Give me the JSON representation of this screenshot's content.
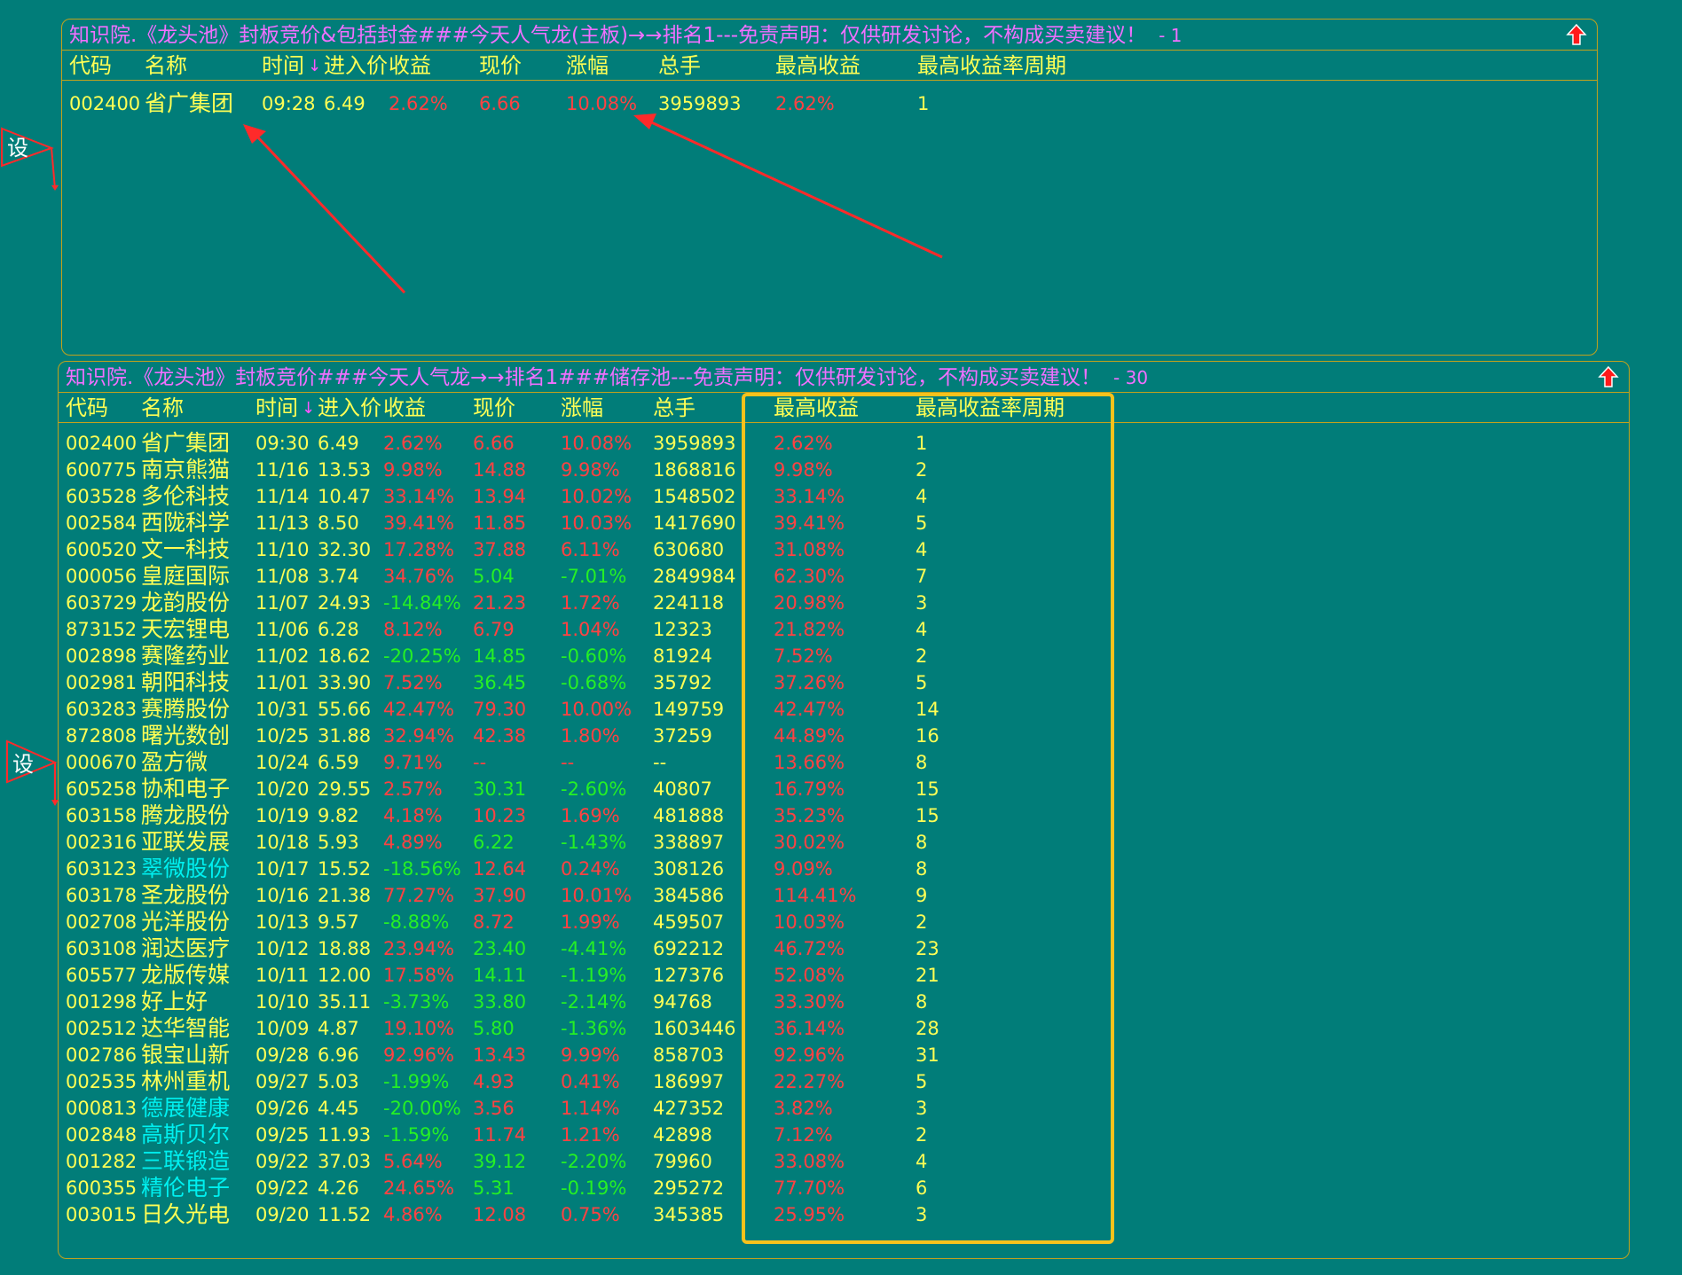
{
  "top_panel": {
    "title": "知识院.《龙头池》封板竞价&包括封金###今天人气龙(主板)→→排名1---免责声明：仅供研发讨论，不构成买卖建议！",
    "count": "- 1",
    "headers": [
      "代码",
      "名称",
      "时间",
      "进入价",
      "收益",
      "现价",
      "涨幅",
      "总手",
      "最高收益",
      "最高收益率周期"
    ],
    "rows": [
      {
        "code": "002400",
        "name": "省广集团",
        "time": "09:28",
        "entry": "6.49",
        "profit": "2.62%",
        "price": "6.66",
        "change": "10.08%",
        "volume": "3959893",
        "max_profit": "2.62%",
        "period": "1",
        "name_color": "yellow",
        "profit_color": "red",
        "price_color": "red",
        "change_color": "red",
        "max_color": "red"
      }
    ]
  },
  "bottom_panel": {
    "title": "知识院.《龙头池》封板竞价###今天人气龙→→排名1###储存池---免责声明：仅供研发讨论，不构成买卖建议！",
    "count": "- 30",
    "headers": [
      "代码",
      "名称",
      "时间",
      "进入价",
      "收益",
      "现价",
      "涨幅",
      "总手",
      "最高收益",
      "最高收益率周期"
    ],
    "rows": [
      {
        "code": "002400",
        "name": "省广集团",
        "time": "09:30",
        "entry": "6.49",
        "profit": "2.62%",
        "price": "6.66",
        "change": "10.08%",
        "volume": "3959893",
        "max_profit": "2.62%",
        "period": "1",
        "name_color": "yellow",
        "profit_color": "red",
        "price_color": "red",
        "change_color": "red"
      },
      {
        "code": "600775",
        "name": "南京熊猫",
        "time": "11/16",
        "entry": "13.53",
        "profit": "9.98%",
        "price": "14.88",
        "change": "9.98%",
        "volume": "1868816",
        "max_profit": "9.98%",
        "period": "2",
        "name_color": "yellow",
        "profit_color": "red",
        "price_color": "red",
        "change_color": "red"
      },
      {
        "code": "603528",
        "name": "多伦科技",
        "time": "11/14",
        "entry": "10.47",
        "profit": "33.14%",
        "price": "13.94",
        "change": "10.02%",
        "volume": "1548502",
        "max_profit": "33.14%",
        "period": "4",
        "name_color": "yellow",
        "profit_color": "red",
        "price_color": "red",
        "change_color": "red"
      },
      {
        "code": "002584",
        "name": "西陇科学",
        "time": "11/13",
        "entry": "8.50",
        "profit": "39.41%",
        "price": "11.85",
        "change": "10.03%",
        "volume": "1417690",
        "max_profit": "39.41%",
        "period": "5",
        "name_color": "yellow",
        "profit_color": "red",
        "price_color": "red",
        "change_color": "red"
      },
      {
        "code": "600520",
        "name": "文一科技",
        "time": "11/10",
        "entry": "32.30",
        "profit": "17.28%",
        "price": "37.88",
        "change": "6.11%",
        "volume": "630680",
        "max_profit": "31.08%",
        "period": "4",
        "name_color": "yellow",
        "profit_color": "red",
        "price_color": "red",
        "change_color": "red"
      },
      {
        "code": "000056",
        "name": "皇庭国际",
        "time": "11/08",
        "entry": "3.74",
        "profit": "34.76%",
        "price": "5.04",
        "change": "-7.01%",
        "volume": "2849984",
        "max_profit": "62.30%",
        "period": "7",
        "name_color": "yellow",
        "profit_color": "red",
        "price_color": "green",
        "change_color": "green"
      },
      {
        "code": "603729",
        "name": "龙韵股份",
        "time": "11/07",
        "entry": "24.93",
        "profit": "-14.84%",
        "price": "21.23",
        "change": "1.72%",
        "volume": "224118",
        "max_profit": "20.98%",
        "period": "3",
        "name_color": "yellow",
        "profit_color": "green",
        "price_color": "red",
        "change_color": "red"
      },
      {
        "code": "873152",
        "name": "天宏锂电",
        "time": "11/06",
        "entry": "6.28",
        "profit": "8.12%",
        "price": "6.79",
        "change": "1.04%",
        "volume": "12323",
        "max_profit": "21.82%",
        "period": "4",
        "name_color": "yellow",
        "profit_color": "red",
        "price_color": "red",
        "change_color": "red"
      },
      {
        "code": "002898",
        "name": "赛隆药业",
        "time": "11/02",
        "entry": "18.62",
        "profit": "-20.25%",
        "price": "14.85",
        "change": "-0.60%",
        "volume": "81924",
        "max_profit": "7.52%",
        "period": "2",
        "name_color": "yellow",
        "profit_color": "green",
        "price_color": "green",
        "change_color": "green"
      },
      {
        "code": "002981",
        "name": "朝阳科技",
        "time": "11/01",
        "entry": "33.90",
        "profit": "7.52%",
        "price": "36.45",
        "change": "-0.68%",
        "volume": "35792",
        "max_profit": "37.26%",
        "period": "5",
        "name_color": "yellow",
        "profit_color": "red",
        "price_color": "green",
        "change_color": "green"
      },
      {
        "code": "603283",
        "name": "赛腾股份",
        "time": "10/31",
        "entry": "55.66",
        "profit": "42.47%",
        "price": "79.30",
        "change": "10.00%",
        "volume": "149759",
        "max_profit": "42.47%",
        "period": "14",
        "name_color": "yellow",
        "profit_color": "red",
        "price_color": "red",
        "change_color": "red"
      },
      {
        "code": "872808",
        "name": "曙光数创",
        "time": "10/25",
        "entry": "31.88",
        "profit": "32.94%",
        "price": "42.38",
        "change": "1.80%",
        "volume": "37259",
        "max_profit": "44.89%",
        "period": "16",
        "name_color": "yellow",
        "profit_color": "red",
        "price_color": "red",
        "change_color": "red"
      },
      {
        "code": "000670",
        "name": "盈方微",
        "time": "10/24",
        "entry": "6.59",
        "profit": "9.71%",
        "price": "--",
        "change": "--",
        "volume": "--",
        "max_profit": "13.66%",
        "period": "8",
        "name_color": "yellow",
        "profit_color": "red",
        "price_color": "red",
        "change_color": "red"
      },
      {
        "code": "605258",
        "name": "协和电子",
        "time": "10/20",
        "entry": "29.55",
        "profit": "2.57%",
        "price": "30.31",
        "change": "-2.60%",
        "volume": "40807",
        "max_profit": "16.79%",
        "period": "15",
        "name_color": "yellow",
        "profit_color": "red",
        "price_color": "green",
        "change_color": "green"
      },
      {
        "code": "603158",
        "name": "腾龙股份",
        "time": "10/19",
        "entry": "9.82",
        "profit": "4.18%",
        "price": "10.23",
        "change": "1.69%",
        "volume": "481888",
        "max_profit": "35.23%",
        "period": "15",
        "name_color": "yellow",
        "profit_color": "red",
        "price_color": "red",
        "change_color": "red"
      },
      {
        "code": "002316",
        "name": "亚联发展",
        "time": "10/18",
        "entry": "5.93",
        "profit": "4.89%",
        "price": "6.22",
        "change": "-1.43%",
        "volume": "338897",
        "max_profit": "30.02%",
        "period": "8",
        "name_color": "yellow",
        "profit_color": "red",
        "price_color": "green",
        "change_color": "green"
      },
      {
        "code": "603123",
        "name": "翠微股份",
        "time": "10/17",
        "entry": "15.52",
        "profit": "-18.56%",
        "price": "12.64",
        "change": "0.24%",
        "volume": "308126",
        "max_profit": "9.09%",
        "period": "8",
        "name_color": "cyan",
        "profit_color": "green",
        "price_color": "red",
        "change_color": "red"
      },
      {
        "code": "603178",
        "name": "圣龙股份",
        "time": "10/16",
        "entry": "21.38",
        "profit": "77.27%",
        "price": "37.90",
        "change": "10.01%",
        "volume": "384586",
        "max_profit": "114.41%",
        "period": "9",
        "name_color": "yellow",
        "profit_color": "red",
        "price_color": "red",
        "change_color": "red"
      },
      {
        "code": "002708",
        "name": "光洋股份",
        "time": "10/13",
        "entry": "9.57",
        "profit": "-8.88%",
        "price": "8.72",
        "change": "1.99%",
        "volume": "459507",
        "max_profit": "10.03%",
        "period": "2",
        "name_color": "yellow",
        "profit_color": "green",
        "price_color": "red",
        "change_color": "red"
      },
      {
        "code": "603108",
        "name": "润达医疗",
        "time": "10/12",
        "entry": "18.88",
        "profit": "23.94%",
        "price": "23.40",
        "change": "-4.41%",
        "volume": "692212",
        "max_profit": "46.72%",
        "period": "23",
        "name_color": "yellow",
        "profit_color": "red",
        "price_color": "green",
        "change_color": "green"
      },
      {
        "code": "605577",
        "name": "龙版传媒",
        "time": "10/11",
        "entry": "12.00",
        "profit": "17.58%",
        "price": "14.11",
        "change": "-1.19%",
        "volume": "127376",
        "max_profit": "52.08%",
        "period": "21",
        "name_color": "yellow",
        "profit_color": "red",
        "price_color": "green",
        "change_color": "green"
      },
      {
        "code": "001298",
        "name": "好上好",
        "time": "10/10",
        "entry": "35.11",
        "profit": "-3.73%",
        "price": "33.80",
        "change": "-2.14%",
        "volume": "94768",
        "max_profit": "33.30%",
        "period": "8",
        "name_color": "yellow",
        "profit_color": "green",
        "price_color": "green",
        "change_color": "green"
      },
      {
        "code": "002512",
        "name": "达华智能",
        "time": "10/09",
        "entry": "4.87",
        "profit": "19.10%",
        "price": "5.80",
        "change": "-1.36%",
        "volume": "1603446",
        "max_profit": "36.14%",
        "period": "28",
        "name_color": "yellow",
        "profit_color": "red",
        "price_color": "green",
        "change_color": "green"
      },
      {
        "code": "002786",
        "name": "银宝山新",
        "time": "09/28",
        "entry": "6.96",
        "profit": "92.96%",
        "price": "13.43",
        "change": "9.99%",
        "volume": "858703",
        "max_profit": "92.96%",
        "period": "31",
        "name_color": "yellow",
        "profit_color": "red",
        "price_color": "red",
        "change_color": "red"
      },
      {
        "code": "002535",
        "name": "林州重机",
        "time": "09/27",
        "entry": "5.03",
        "profit": "-1.99%",
        "price": "4.93",
        "change": "0.41%",
        "volume": "186997",
        "max_profit": "22.27%",
        "period": "5",
        "name_color": "yellow",
        "profit_color": "green",
        "price_color": "red",
        "change_color": "red"
      },
      {
        "code": "000813",
        "name": "德展健康",
        "time": "09/26",
        "entry": "4.45",
        "profit": "-20.00%",
        "price": "3.56",
        "change": "1.14%",
        "volume": "427352",
        "max_profit": "3.82%",
        "period": "3",
        "name_color": "cyan",
        "profit_color": "green",
        "price_color": "red",
        "change_color": "red"
      },
      {
        "code": "002848",
        "name": "高斯贝尔",
        "time": "09/25",
        "entry": "11.93",
        "profit": "-1.59%",
        "price": "11.74",
        "change": "1.21%",
        "volume": "42898",
        "max_profit": "7.12%",
        "period": "2",
        "name_color": "cyan",
        "profit_color": "green",
        "price_color": "red",
        "change_color": "red"
      },
      {
        "code": "001282",
        "name": "三联锻造",
        "time": "09/22",
        "entry": "37.03",
        "profit": "5.64%",
        "price": "39.12",
        "change": "-2.20%",
        "volume": "79960",
        "max_profit": "33.08%",
        "period": "4",
        "name_color": "cyan",
        "profit_color": "red",
        "price_color": "green",
        "change_color": "green"
      },
      {
        "code": "600355",
        "name": "精伦电子",
        "time": "09/22",
        "entry": "4.26",
        "profit": "24.65%",
        "price": "5.31",
        "change": "-0.19%",
        "volume": "295272",
        "max_profit": "77.70%",
        "period": "6",
        "name_color": "cyan",
        "profit_color": "red",
        "price_color": "green",
        "change_color": "green"
      },
      {
        "code": "003015",
        "name": "日久光电",
        "time": "09/20",
        "entry": "11.52",
        "profit": "4.86%",
        "price": "12.08",
        "change": "0.75%",
        "volume": "345385",
        "max_profit": "25.95%",
        "period": "3",
        "name_color": "yellow",
        "profit_color": "red",
        "price_color": "red",
        "change_color": "red"
      }
    ]
  },
  "side_label": "设",
  "sort_arrow": "↓",
  "colors": {
    "background": "#017d79",
    "border": "#c2a21c",
    "title": "#f070ff",
    "yellow": "#ffff55",
    "red": "#ff4242",
    "green": "#25f025",
    "cyan": "#00f0f0",
    "highlight": "#f6c21c",
    "annotation_arrow": "#ff2a2a"
  },
  "icons": {
    "collapse": "up-arrow-icon",
    "settings_marker": "triangle-marker-icon"
  }
}
